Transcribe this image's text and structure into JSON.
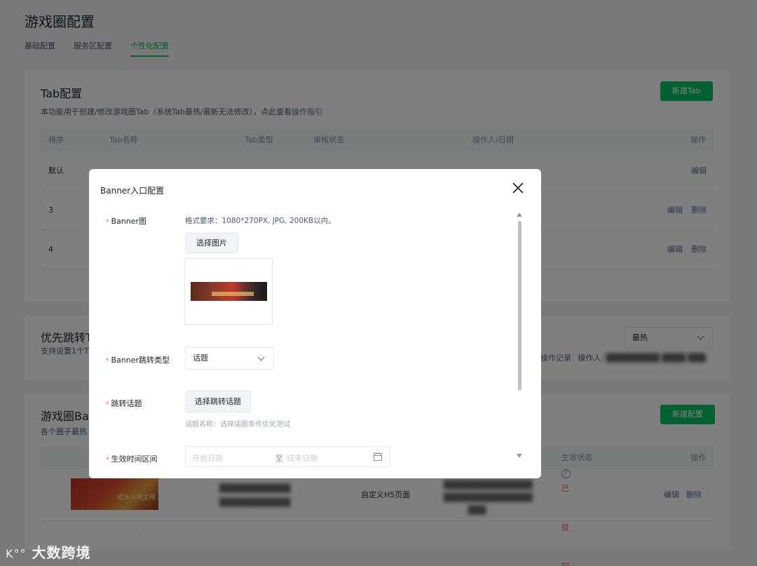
{
  "page": {
    "title": "游戏圈配置"
  },
  "tabs": [
    {
      "label": "基础配置"
    },
    {
      "label": "服务区配置"
    },
    {
      "label": "个性化配置"
    }
  ],
  "tab_card": {
    "title": "Tab配置",
    "desc_prefix": "本功能用于创建/修改游戏圈Tab（系统Tab最热/最新无法修改），点此查看",
    "desc_link": "操作指引",
    "new_button": "新建Tab",
    "columns": [
      "排序",
      "Tab名称",
      "Tab类型",
      "审核状态",
      "操作人/日期",
      "操作"
    ],
    "rows": [
      {
        "order": "默认",
        "ops": [
          "编辑"
        ]
      },
      {
        "order": "3",
        "ops": [
          "编辑",
          "删除"
        ]
      },
      {
        "order": "4",
        "ops": [
          "编辑",
          "删除"
        ]
      }
    ]
  },
  "priority_card": {
    "title": "优先跳转T",
    "desc": "支持设置1个T",
    "select_value": "最热",
    "record_link": "操作记录",
    "operator_label": "操作人:"
  },
  "banner_card": {
    "title": "游戏圈Ba",
    "desc": "各个圈子最热",
    "new_button": "新建配置",
    "columns": [
      "生效状态",
      "操作"
    ],
    "row": {
      "type": "自定义H5页面",
      "status": "已驳回",
      "ops": [
        "编辑",
        "删除"
      ],
      "thumb_text": "欢乐斗地主拜年季"
    }
  },
  "modal": {
    "title": "Banner入口配置",
    "banner_label": "Banner图",
    "banner_hint": "格式要求：1080*270PX, JPG, 200KB以内。",
    "choose_image": "选择图片",
    "jump_type_label": "Banner跳转类型",
    "jump_type_value": "话题",
    "jump_topic_label": "跳转话题",
    "choose_topic": "选择跳转话题",
    "topic_name_hint": "话题名称：选择话题条件优化测试",
    "time_label": "生效时间区间",
    "start_placeholder": "开始日期",
    "to_label": "至",
    "end_placeholder": "结束日期"
  },
  "watermark": "大数跨境",
  "colors": {
    "primary": "#07c160",
    "link": "#576b95",
    "danger": "#fa5151"
  }
}
